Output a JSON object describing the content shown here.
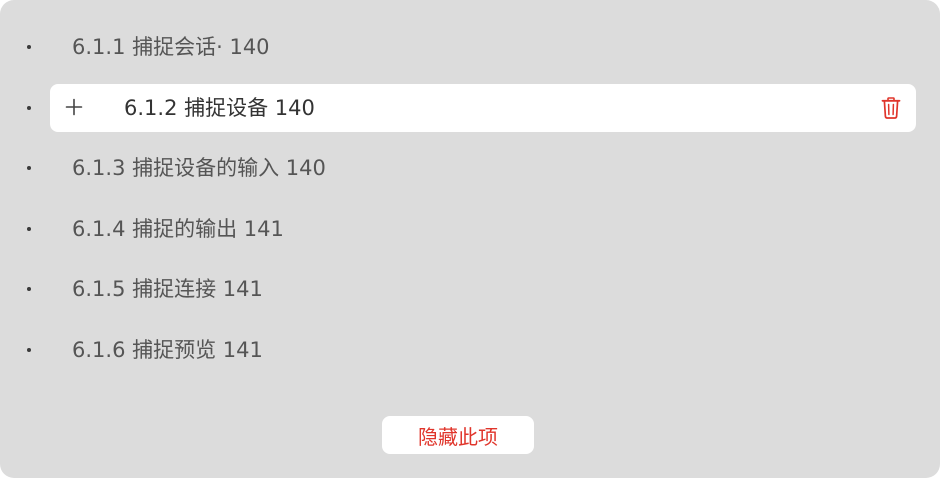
{
  "toc": {
    "items": [
      {
        "label": "6.1.1 捕捉会话· 140"
      },
      {
        "label": "6.1.2 捕捉设备 140"
      },
      {
        "label": "6.1.3 捕捉设备的输入 140"
      },
      {
        "label": "6.1.4 捕捉的输出 141"
      },
      {
        "label": "6.1.5 捕捉连接 141"
      },
      {
        "label": "6.1.6 捕捉预览 141"
      }
    ],
    "selected_index": 1
  },
  "actions": {
    "hide_label": "隐藏此项",
    "add_icon": "plus-icon",
    "delete_icon": "trash-icon"
  },
  "colors": {
    "panel_bg": "#dcdcdc",
    "text": "#555555",
    "accent_red": "#e0352b",
    "selected_bg": "#ffffff"
  }
}
